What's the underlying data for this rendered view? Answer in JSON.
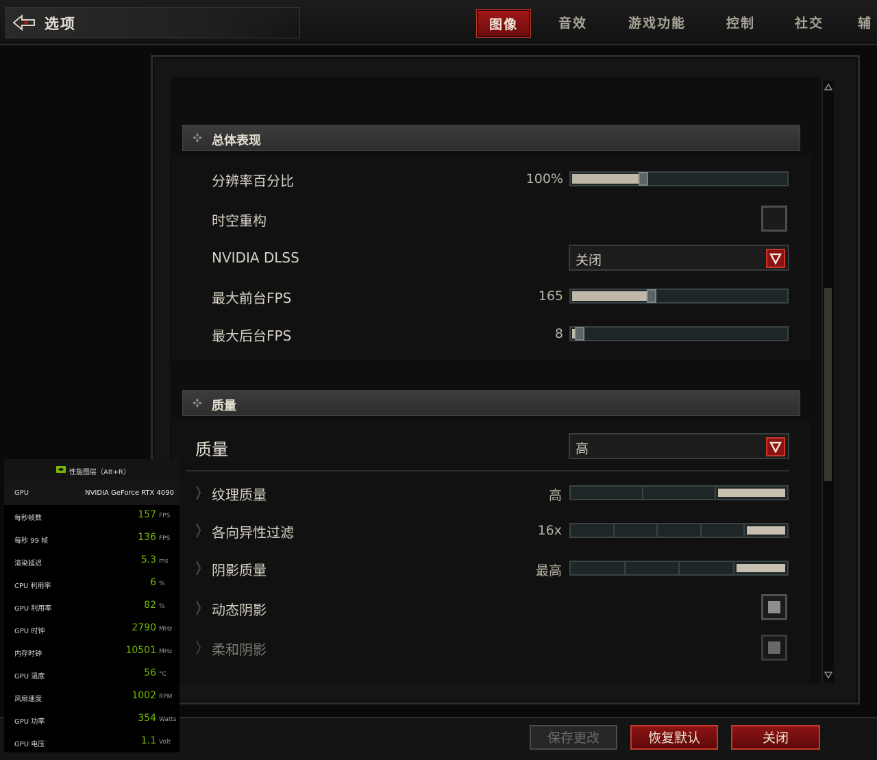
{
  "header": {
    "title": "选项",
    "tabs": [
      {
        "label": "图像",
        "active": true
      },
      {
        "label": "音效",
        "active": false
      },
      {
        "label": "游戏功能",
        "active": false
      },
      {
        "label": "控制",
        "active": false
      },
      {
        "label": "社交",
        "active": false
      },
      {
        "label": "辅",
        "active": false
      }
    ]
  },
  "sections": {
    "general": {
      "title": "总体表现",
      "resolution": {
        "label": "分辨率百分比",
        "value": "100%",
        "level": 0.33
      },
      "temporal": {
        "label": "时空重构",
        "checked": false
      },
      "dlss": {
        "label": "NVIDIA DLSS",
        "value": "关闭"
      },
      "max_fg_fps": {
        "label": "最大前台FPS",
        "value": "165",
        "level": 0.37
      },
      "max_bg_fps": {
        "label": "最大后台FPS",
        "value": "8",
        "level": 0.02
      }
    },
    "quality": {
      "title": "质量",
      "preset": {
        "label": "质量",
        "value": "高"
      },
      "texture": {
        "label": "纹理质量",
        "value": "高",
        "segments": 3,
        "selected": 3
      },
      "aniso": {
        "label": "各向异性过滤",
        "value": "16x",
        "segments": 5,
        "selected": 5
      },
      "shadow": {
        "label": "阴影质量",
        "value": "最高",
        "segments": 4,
        "selected": 4
      },
      "dynamic_shadow": {
        "label": "动态阴影",
        "checked": true
      },
      "soft_shadow": {
        "label": "柔和阴影",
        "checked": true
      }
    }
  },
  "footer": {
    "save": "保存更改",
    "reset": "恢复默认",
    "close": "关闭"
  },
  "overlay": {
    "title": "性能图层（Alt+R）",
    "gpu_label": "GPU",
    "gpu_name": "NVIDIA GeForce RTX 4090",
    "rows": [
      {
        "label": "每秒帧数",
        "value": "157",
        "unit": "FPS"
      },
      {
        "label": "每秒 99 帧",
        "value": "136",
        "unit": "FPS"
      },
      {
        "label": "渲染延迟",
        "value": "5.3",
        "unit": "ms"
      },
      {
        "label": "CPU 利用率",
        "value": "6",
        "unit": "%"
      },
      {
        "label": "GPU 利用率",
        "value": "82",
        "unit": "%"
      },
      {
        "label": "GPU 时钟",
        "value": "2790",
        "unit": "MHz"
      },
      {
        "label": "内存时钟",
        "value": "10501",
        "unit": "MHz"
      },
      {
        "label": "GPU 温度",
        "value": "56",
        "unit": "°C"
      },
      {
        "label": "风扇速度",
        "value": "1002",
        "unit": "RPM"
      },
      {
        "label": "GPU 功率",
        "value": "354",
        "unit": "Watts"
      },
      {
        "label": "GPU 电压",
        "value": "1.1",
        "unit": "Volt"
      }
    ]
  },
  "colors": {
    "accent_red": "#a01818",
    "overlay_green": "#76b900"
  }
}
